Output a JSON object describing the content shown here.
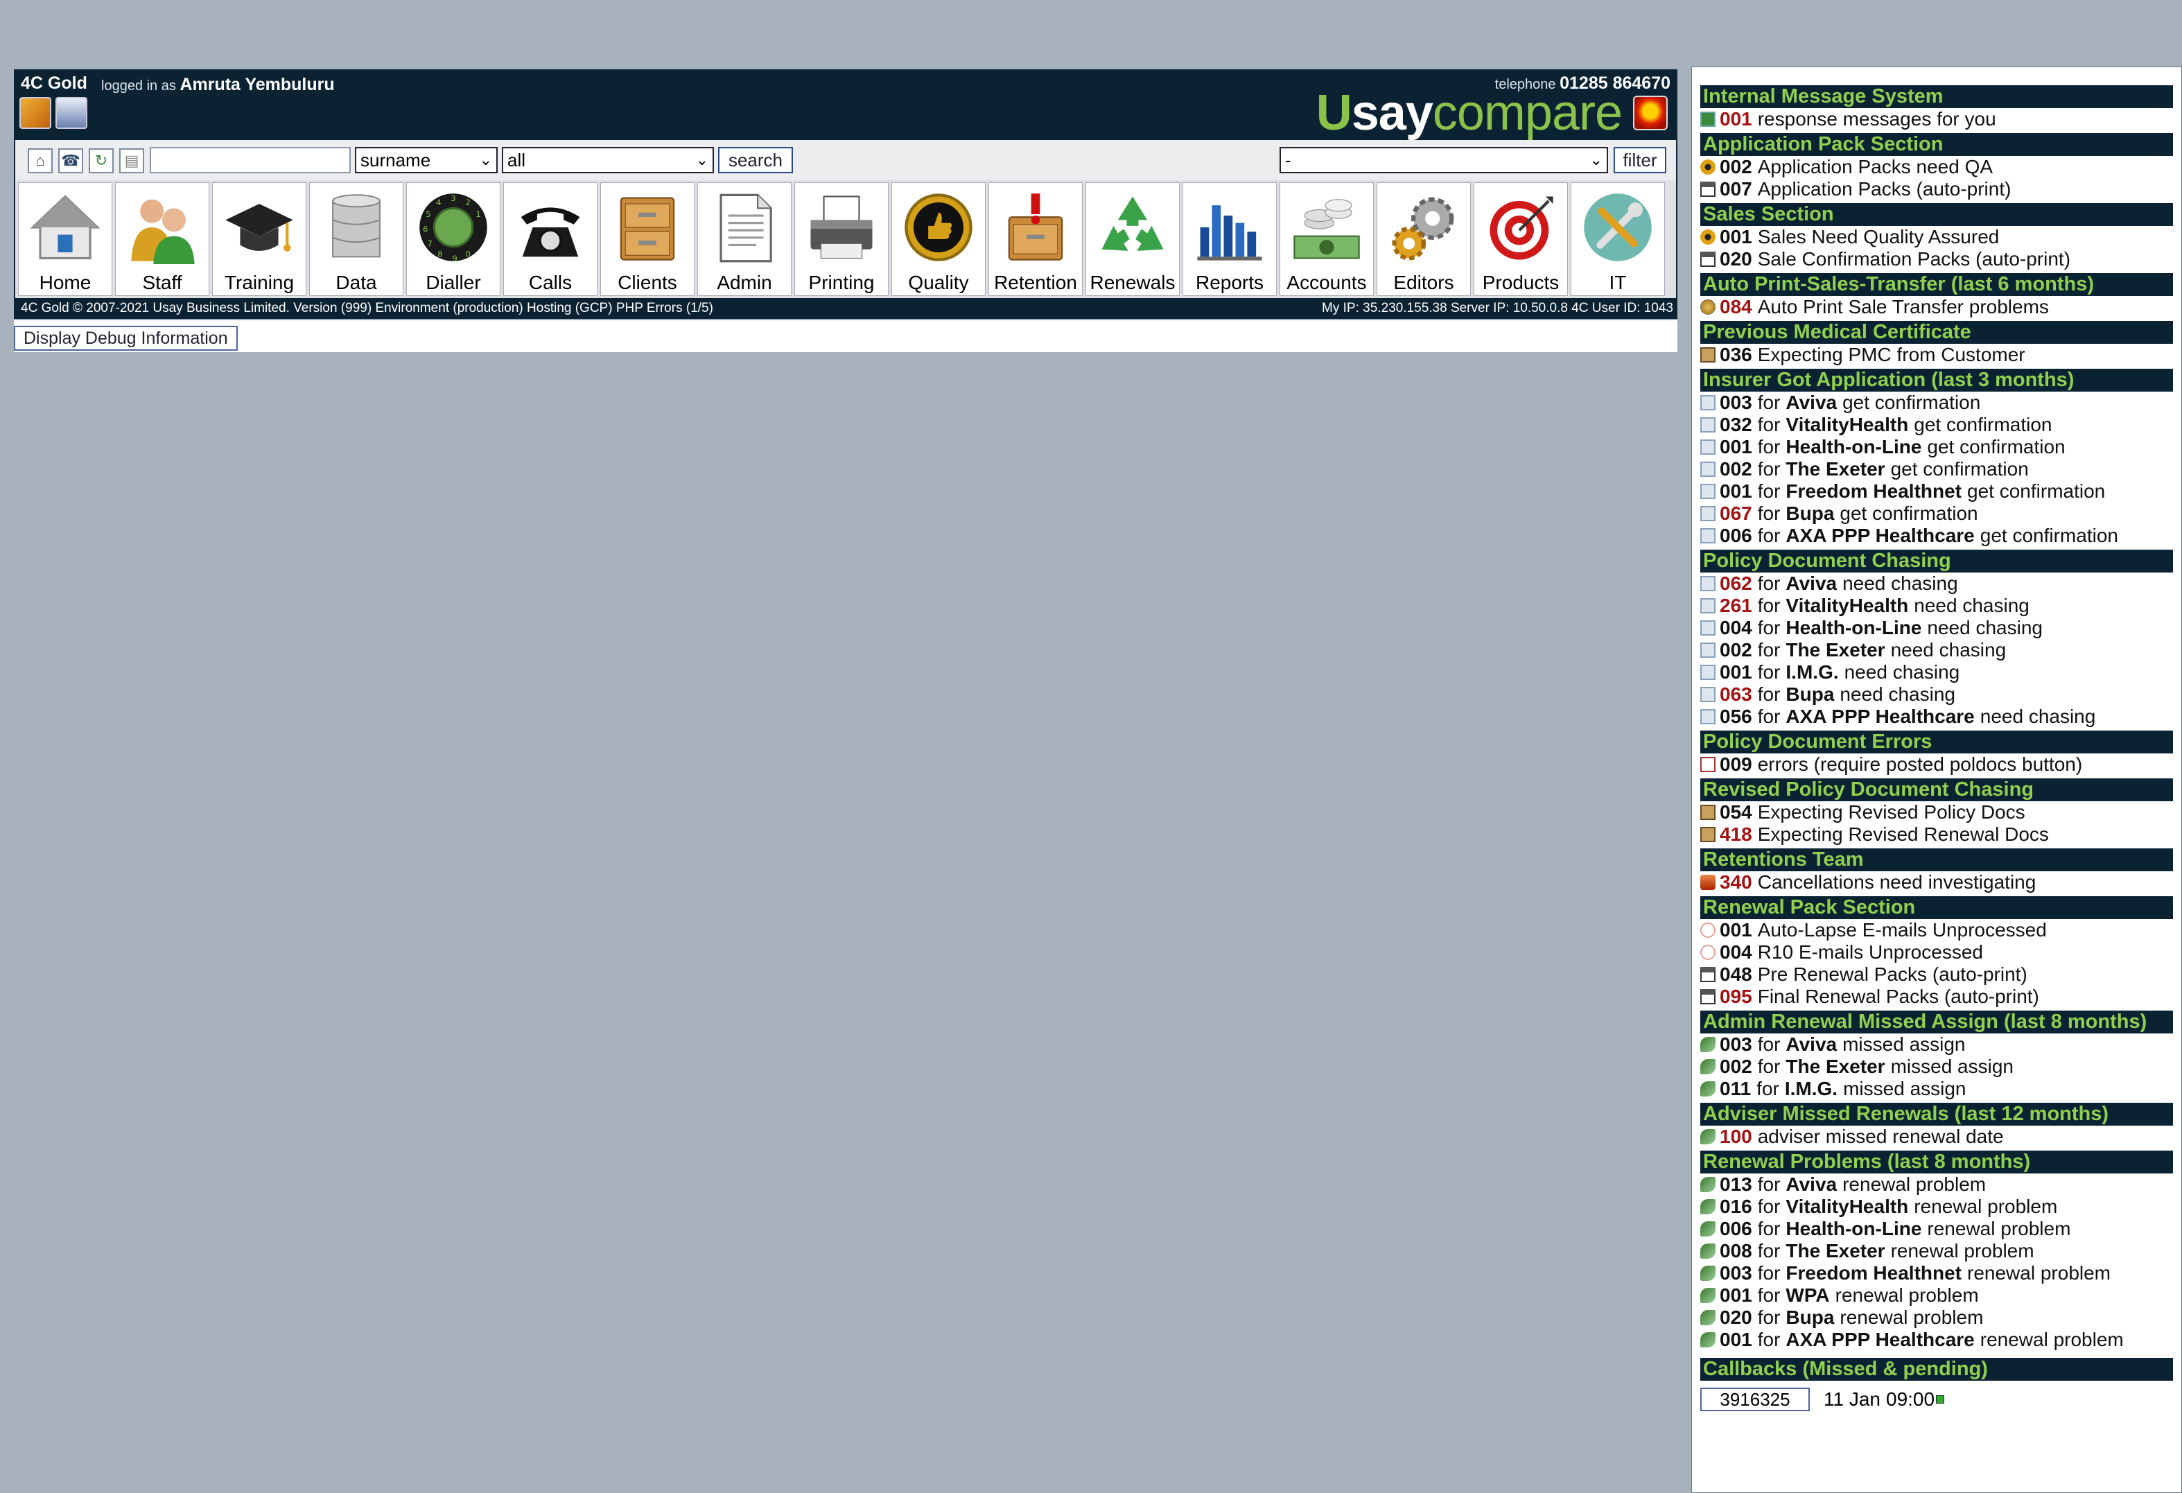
{
  "header": {
    "app_name": "4C Gold",
    "logged_in_prefix": "logged in as",
    "user_name": "Amruta Yembuluru",
    "telephone_prefix": "telephone",
    "telephone": "01285 864670",
    "logo": {
      "u": "U",
      "say": "say",
      "compare": "compare"
    }
  },
  "search": {
    "field_value": "",
    "field_select": "surname",
    "scope_select": "all",
    "search_label": "search",
    "filter_select": "-",
    "filter_label": "filter"
  },
  "toolbar": [
    {
      "label": "Home",
      "icon": "home-icon"
    },
    {
      "label": "Staff",
      "icon": "staff-icon"
    },
    {
      "label": "Training",
      "icon": "graduation-cap-icon"
    },
    {
      "label": "Data",
      "icon": "database-icon"
    },
    {
      "label": "Dialler",
      "icon": "rotary-dial-icon"
    },
    {
      "label": "Calls",
      "icon": "telephone-icon"
    },
    {
      "label": "Clients",
      "icon": "filing-cabinet-icon"
    },
    {
      "label": "Admin",
      "icon": "document-icon"
    },
    {
      "label": "Printing",
      "icon": "printer-icon"
    },
    {
      "label": "Quality",
      "icon": "thumbs-up-medal-icon"
    },
    {
      "label": "Retention",
      "icon": "alert-cabinet-icon"
    },
    {
      "label": "Renewals",
      "icon": "recycle-icon"
    },
    {
      "label": "Reports",
      "icon": "bar-chart-icon"
    },
    {
      "label": "Accounts",
      "icon": "coins-icon"
    },
    {
      "label": "Editors",
      "icon": "gears-icon"
    },
    {
      "label": "Products",
      "icon": "target-icon"
    },
    {
      "label": "IT",
      "icon": "tools-icon"
    }
  ],
  "footer": {
    "left": "4C Gold © 2007-2021 Usay Business Limited. Version (999) Environment (production) Hosting (GCP) PHP Errors (1/5)",
    "right": "My IP: 35.230.155.38 Server IP: 10.50.0.8 4C User ID: 1043"
  },
  "debug_button": "Display Debug Information",
  "sidebar": {
    "sections": [
      {
        "title": "Internal Message System",
        "rows": [
          {
            "icon": "msg",
            "num": "001",
            "red": true,
            "text": "response messages for you"
          }
        ]
      },
      {
        "title": "Application Pack Section",
        "rows": [
          {
            "icon": "qa",
            "num": "002",
            "red": false,
            "text": "Application Packs need QA"
          },
          {
            "icon": "print",
            "num": "007",
            "red": false,
            "text": "Application Packs (auto-print)"
          }
        ]
      },
      {
        "title": "Sales Section",
        "rows": [
          {
            "icon": "qa",
            "num": "001",
            "red": false,
            "text": "Sales Need Quality Assured"
          },
          {
            "icon": "print",
            "num": "020",
            "red": false,
            "text": "Sale Confirmation Packs (auto-print)"
          }
        ]
      },
      {
        "title": "Auto Print-Sales-Transfer (last 6 months)",
        "rows": [
          {
            "icon": "globe",
            "num": "084",
            "red": true,
            "text": "Auto Print Sale Transfer problems"
          }
        ]
      },
      {
        "title": "Previous Medical Certificate",
        "rows": [
          {
            "icon": "cert",
            "num": "036",
            "red": false,
            "text": "Expecting PMC from Customer"
          }
        ]
      },
      {
        "title": "Insurer Got Application (last 3 months)",
        "rows": [
          {
            "icon": "doc",
            "num": "003",
            "red": false,
            "pre": "for",
            "insurer": "Aviva",
            "text": "get confirmation"
          },
          {
            "icon": "doc",
            "num": "032",
            "red": false,
            "pre": "for",
            "insurer": "VitalityHealth",
            "text": "get confirmation"
          },
          {
            "icon": "doc",
            "num": "001",
            "red": false,
            "pre": "for",
            "insurer": "Health-on-Line",
            "text": "get confirmation"
          },
          {
            "icon": "doc",
            "num": "002",
            "red": false,
            "pre": "for",
            "insurer": "The Exeter",
            "text": "get confirmation"
          },
          {
            "icon": "doc",
            "num": "001",
            "red": false,
            "pre": "for",
            "insurer": "Freedom Healthnet",
            "text": "get confirmation"
          },
          {
            "icon": "doc",
            "num": "067",
            "red": true,
            "pre": "for",
            "insurer": "Bupa",
            "text": "get confirmation"
          },
          {
            "icon": "doc",
            "num": "006",
            "red": false,
            "pre": "for",
            "insurer": "AXA PPP Healthcare",
            "text": "get confirmation"
          }
        ]
      },
      {
        "title": "Policy Document Chasing",
        "rows": [
          {
            "icon": "doc",
            "num": "062",
            "red": true,
            "pre": "for",
            "insurer": "Aviva",
            "text": "need chasing"
          },
          {
            "icon": "doc",
            "num": "261",
            "red": true,
            "pre": "for",
            "insurer": "VitalityHealth",
            "text": "need chasing"
          },
          {
            "icon": "doc",
            "num": "004",
            "red": false,
            "pre": "for",
            "insurer": "Health-on-Line",
            "text": "need chasing"
          },
          {
            "icon": "doc",
            "num": "002",
            "red": false,
            "pre": "for",
            "insurer": "The Exeter",
            "text": "need chasing"
          },
          {
            "icon": "doc",
            "num": "001",
            "red": false,
            "pre": "for",
            "insurer": "I.M.G.",
            "text": "need chasing"
          },
          {
            "icon": "doc",
            "num": "063",
            "red": true,
            "pre": "for",
            "insurer": "Bupa",
            "text": "need chasing"
          },
          {
            "icon": "doc",
            "num": "056",
            "red": false,
            "pre": "for",
            "insurer": "AXA PPP Healthcare",
            "text": "need chasing"
          }
        ]
      },
      {
        "title": "Policy Document Errors",
        "rows": [
          {
            "icon": "err",
            "num": "009",
            "red": false,
            "text": "errors (require posted poldocs button)"
          }
        ]
      },
      {
        "title": "Revised Policy Document Chasing",
        "rows": [
          {
            "icon": "cert",
            "num": "054",
            "red": false,
            "text": "Expecting Revised Policy Docs"
          },
          {
            "icon": "cert",
            "num": "418",
            "red": true,
            "text": "Expecting Revised Renewal Docs"
          }
        ]
      },
      {
        "title": "Retentions Team",
        "rows": [
          {
            "icon": "fire",
            "num": "340",
            "red": true,
            "text": "Cancellations need investigating"
          }
        ]
      },
      {
        "title": "Renewal Pack Section",
        "rows": [
          {
            "icon": "mail",
            "num": "001",
            "red": false,
            "text": "Auto-Lapse E-mails Unprocessed"
          },
          {
            "icon": "mail",
            "num": "004",
            "red": false,
            "text": "R10 E-mails Unprocessed"
          },
          {
            "icon": "print",
            "num": "048",
            "red": false,
            "text": "Pre Renewal Packs (auto-print)"
          },
          {
            "icon": "print",
            "num": "095",
            "red": true,
            "text": "Final Renewal Packs (auto-print)"
          }
        ]
      },
      {
        "title": "Admin Renewal Missed Assign (last 8 months)",
        "rows": [
          {
            "icon": "money",
            "num": "003",
            "red": false,
            "pre": "for",
            "insurer": "Aviva",
            "text": "missed assign"
          },
          {
            "icon": "money",
            "num": "002",
            "red": false,
            "pre": "for",
            "insurer": "The Exeter",
            "text": "missed assign"
          },
          {
            "icon": "money",
            "num": "011",
            "red": false,
            "pre": "for",
            "insurer": "I.M.G.",
            "text": "missed assign"
          }
        ]
      },
      {
        "title": "Adviser Missed Renewals (last 12 months)",
        "rows": [
          {
            "icon": "money",
            "num": "100",
            "red": true,
            "text": "adviser missed renewal date"
          }
        ]
      },
      {
        "title": "Renewal Problems (last 8 months)",
        "rows": [
          {
            "icon": "money",
            "num": "013",
            "red": false,
            "pre": "for",
            "insurer": "Aviva",
            "text": "renewal problem"
          },
          {
            "icon": "money",
            "num": "016",
            "red": false,
            "pre": "for",
            "insurer": "VitalityHealth",
            "text": "renewal problem"
          },
          {
            "icon": "money",
            "num": "006",
            "red": false,
            "pre": "for",
            "insurer": "Health-on-Line",
            "text": "renewal problem"
          },
          {
            "icon": "money",
            "num": "008",
            "red": false,
            "pre": "for",
            "insurer": "The Exeter",
            "text": "renewal problem"
          },
          {
            "icon": "money",
            "num": "003",
            "red": false,
            "pre": "for",
            "insurer": "Freedom Healthnet",
            "text": "renewal problem"
          },
          {
            "icon": "money",
            "num": "001",
            "red": false,
            "pre": "for",
            "insurer": "WPA",
            "text": "renewal problem"
          },
          {
            "icon": "money",
            "num": "020",
            "red": false,
            "pre": "for",
            "insurer": "Bupa",
            "text": "renewal problem"
          },
          {
            "icon": "money",
            "num": "001",
            "red": false,
            "pre": "for",
            "insurer": "AXA PPP Healthcare",
            "text": "renewal problem"
          }
        ]
      }
    ],
    "callbacks": {
      "title": "Callbacks (Missed & pending)",
      "client_id": "3916325",
      "date": "11 Jan",
      "time": "09:00"
    }
  },
  "colors": {
    "header_bg": "#0b2233",
    "section_title": "#8fd14f",
    "count_alert": "#a31212",
    "page_bg": "#a8b2bc"
  }
}
